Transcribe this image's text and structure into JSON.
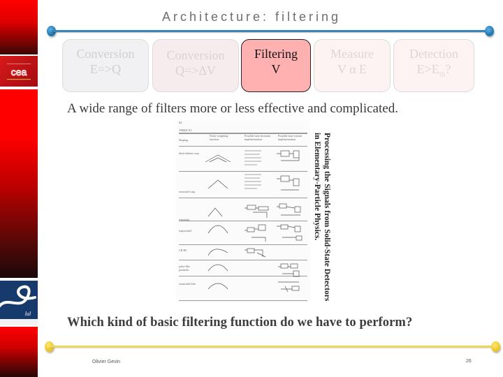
{
  "slide": {
    "title": "Architecture: filtering",
    "pipeline": [
      {
        "line1": "Conversion",
        "line2": "E=>Q",
        "state": "inactive"
      },
      {
        "line1": "Conversion",
        "line2": "Q=>ΔV",
        "state": "inactive"
      },
      {
        "line1": "Filtering",
        "line2": "V",
        "state": "active"
      },
      {
        "line1": "Measure",
        "line2": "V α E",
        "state": "inactive"
      },
      {
        "line1": "Detection",
        "line2_main": "E>E",
        "line2_sub": "th",
        "line2_suffix": "?",
        "state": "inactive"
      }
    ],
    "subtitle": "A wide range of filters more or less effective and complicated.",
    "figure": {
      "page_number": "64",
      "table_label": "TABLE 8.1",
      "columns": [
        "Shaping",
        "Noise weighting function",
        "Possible time-invariant implementation",
        "Possible time-variant implementation"
      ],
      "rows": [
        "ideal infinite cusp",
        "truncated cusp",
        "triangular",
        "trapezoidal",
        "CR-RC",
        "pulse-like parabolic",
        "sinusoidal lobe"
      ],
      "book_title_line1": "Processing the Signals from Solid-State Detectors",
      "book_title_line2": "in Elementary-Particle Physics."
    },
    "question": "Which kind of basic filtering function do we have to perform?"
  },
  "sidebar": {
    "logo_top": "cea",
    "logo_bottom": "lal"
  },
  "footer": {
    "author": "Olivier Gevin",
    "page_number": "26"
  },
  "colors": {
    "active_box": "#ffb0b0",
    "title_rule": "#3b86b8",
    "footer_rule": "#ecd35a",
    "sidebar_red": "#ff0000"
  }
}
